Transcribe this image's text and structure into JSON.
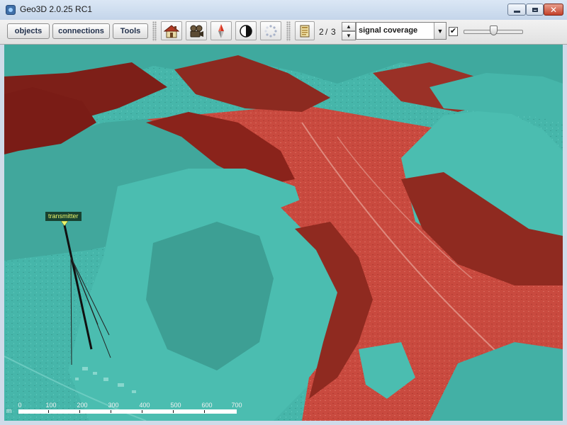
{
  "window": {
    "title": "Geo3D 2.0.25 RC1",
    "close_glyph": "✕"
  },
  "toolbar": {
    "menu_buttons": [
      "objects",
      "connections",
      "Tools"
    ],
    "icons": [
      "home-icon",
      "camera-icon",
      "compass-icon",
      "contrast-icon",
      "loading-icon"
    ],
    "layer": {
      "current": "2",
      "separator": "/",
      "total": "3"
    },
    "up_glyph": "▲",
    "down_glyph": "▼",
    "layer_select": {
      "value": "signal coverage",
      "arrow": "▼"
    },
    "layer_visible": {
      "checked": true,
      "glyph": "✔"
    },
    "opacity_slider": {
      "value": 0.5
    }
  },
  "map": {
    "marker_label": "transmitter",
    "scale_bar": {
      "unit": "m",
      "ticks": [
        "0",
        "100",
        "200",
        "300",
        "400",
        "500",
        "600",
        "700"
      ]
    },
    "colors": {
      "no_coverage": "#c94a3f",
      "coverage": "#43b3a8",
      "transmitter_mast": "#111111",
      "label_text": "#e9f56b"
    }
  }
}
